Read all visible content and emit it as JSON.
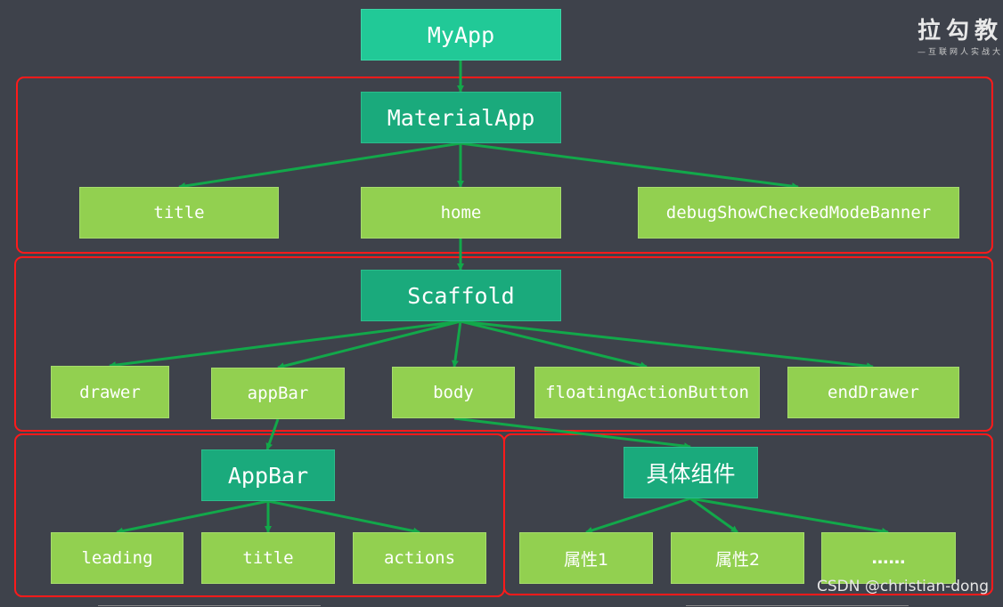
{
  "logo": {
    "main": "拉勾教",
    "tagline": "—互联网人实战大"
  },
  "watermark": "CSDN @christian-dong",
  "nodes": {
    "myapp": "MyApp",
    "materialapp": "MaterialApp",
    "title": "title",
    "home": "home",
    "debug": "debugShowCheckedModeBanner",
    "scaffold": "Scaffold",
    "drawer": "drawer",
    "appbar_prop": "appBar",
    "body": "body",
    "fab": "floatingActionButton",
    "enddrawer": "endDrawer",
    "appbar": "AppBar",
    "component": "具体组件",
    "leading": "leading",
    "appbar_title": "title",
    "actions": "actions",
    "attr1": "属性1",
    "attr2": "属性2",
    "more": "……"
  },
  "colors": {
    "background": "#3e424b",
    "root": "#21c997",
    "widget": "#1aaa7c",
    "property": "#92d050",
    "arrow": "#12a84a",
    "group_frame": "#ff1a1a"
  }
}
